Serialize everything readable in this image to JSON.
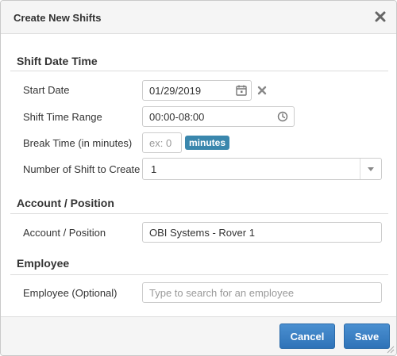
{
  "dialog": {
    "title": "Create New Shifts"
  },
  "sections": {
    "shift_date_time": {
      "title": "Shift Date Time",
      "start_date": {
        "label": "Start Date",
        "value": "01/29/2019"
      },
      "shift_time_range": {
        "label": "Shift Time Range",
        "value": "00:00-08:00"
      },
      "break_time": {
        "label": "Break Time (in minutes)",
        "placeholder": "ex: 0",
        "unit": "minutes"
      },
      "number_of_shift": {
        "label": "Number of Shift to Create",
        "selected": "1"
      }
    },
    "account_position": {
      "title": "Account / Position",
      "field": {
        "label": "Account / Position",
        "value": "OBI Systems - Rover 1"
      }
    },
    "employee": {
      "title": "Employee",
      "field": {
        "label": "Employee (Optional)",
        "placeholder": "Type to search for an employee"
      }
    }
  },
  "footer": {
    "cancel_label": "Cancel",
    "save_label": "Save"
  },
  "colors": {
    "primary_button": "#2f73b8",
    "addon_badge": "#3a87ad",
    "header_background": "#f5f5f5"
  },
  "icons": {
    "close": "close-icon",
    "calendar": "calendar-icon",
    "clear": "clear-icon",
    "clock": "clock-icon",
    "dropdown": "chevron-down-icon"
  }
}
